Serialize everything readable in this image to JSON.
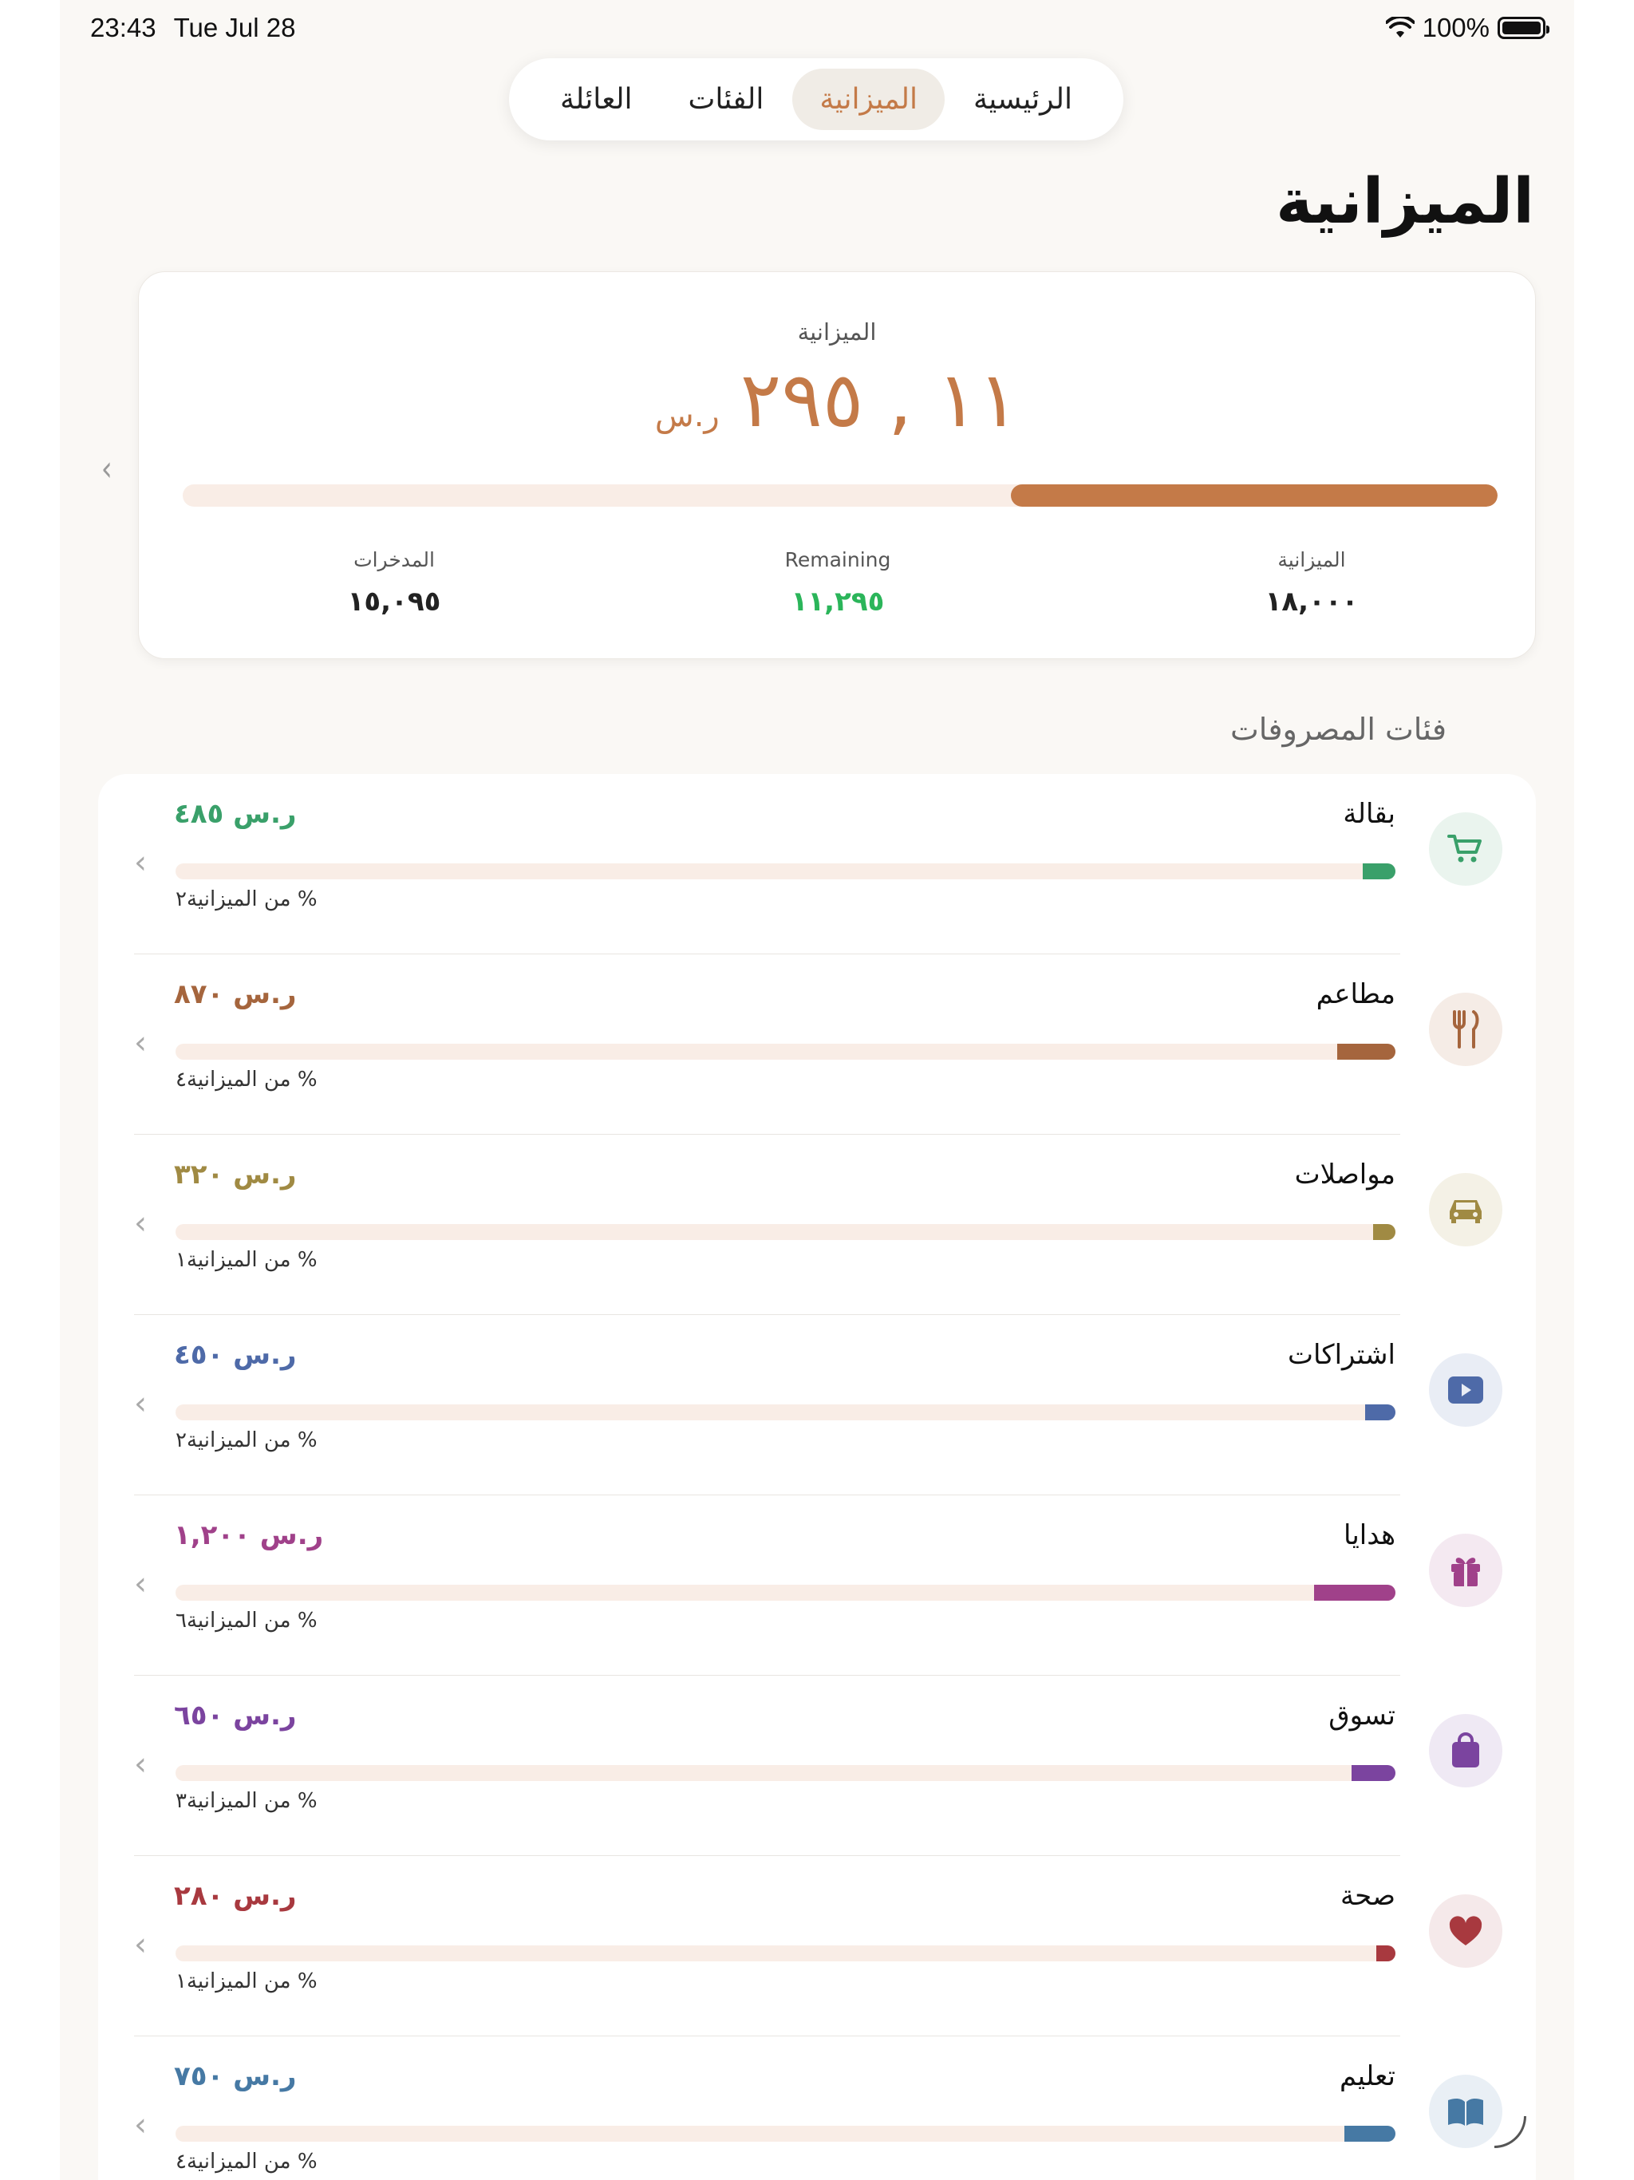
{
  "status": {
    "time": "23:43",
    "date": "Tue Jul 28",
    "battery": "100%"
  },
  "tabs": [
    {
      "label": "الرئيسية",
      "active": false
    },
    {
      "label": "الميزانية",
      "active": true
    },
    {
      "label": "الفئات",
      "active": false
    },
    {
      "label": "العائلة",
      "active": false
    }
  ],
  "page_title": "الميزانية",
  "summary": {
    "label": "الميزانية",
    "amount": "١١ , ٢٩٥",
    "currency": "ر.س",
    "progress_fraction": 0.37,
    "stats": [
      {
        "label": "الميزانية",
        "value": "١٨,٠٠٠"
      },
      {
        "label": "Remaining",
        "value": "١١,٢٩٥"
      },
      {
        "label": "المدخرات",
        "value": "١٥,٠٩٥"
      }
    ]
  },
  "section_title": "فئات المصروفات",
  "colors": {
    "accent": "#c47a48",
    "green": "#2bb55a"
  },
  "categories": [
    {
      "name": "بقالة",
      "amount": "ر.س ٤٨٥",
      "pct": "% من الميزانية٢",
      "fraction": 0.027,
      "color": "#3aa06a",
      "icon_bg": "#eaf4ee",
      "icon": "cart-icon"
    },
    {
      "name": "مطاعم",
      "amount": "ر.س ٨٧٠",
      "pct": "% من الميزانية٤",
      "fraction": 0.048,
      "color": "#a5653d",
      "icon_bg": "#f5ece6",
      "icon": "fork-knife-icon"
    },
    {
      "name": "مواصلات",
      "amount": "ر.س ٣٢٠",
      "pct": "% من الميزانية١",
      "fraction": 0.018,
      "color": "#a08a43",
      "icon_bg": "#f4f1e6",
      "icon": "car-icon"
    },
    {
      "name": "اشتراكات",
      "amount": "ر.س ٤٥٠",
      "pct": "% من الميزانية٢",
      "fraction": 0.025,
      "color": "#4e6aa8",
      "icon_bg": "#e9edf5",
      "icon": "play-icon"
    },
    {
      "name": "هدايا",
      "amount": "ر.س ١,٢٠٠",
      "pct": "% من الميزانية٦",
      "fraction": 0.067,
      "color": "#a0418a",
      "icon_bg": "#f4e9f1",
      "icon": "gift-icon"
    },
    {
      "name": "تسوق",
      "amount": "ر.س ٦٥٠",
      "pct": "% من الميزانية٣",
      "fraction": 0.036,
      "color": "#7b449f",
      "icon_bg": "#efe9f4",
      "icon": "bag-icon"
    },
    {
      "name": "صحة",
      "amount": "ر.س ٢٨٠",
      "pct": "% من الميزانية١",
      "fraction": 0.016,
      "color": "#a8393f",
      "icon_bg": "#f5e9ea",
      "icon": "heart-icon"
    },
    {
      "name": "تعليم",
      "amount": "ر.س ٧٥٠",
      "pct": "% من الميزانية٤",
      "fraction": 0.042,
      "color": "#4679a4",
      "icon_bg": "#e9eff5",
      "icon": "book-icon"
    }
  ]
}
